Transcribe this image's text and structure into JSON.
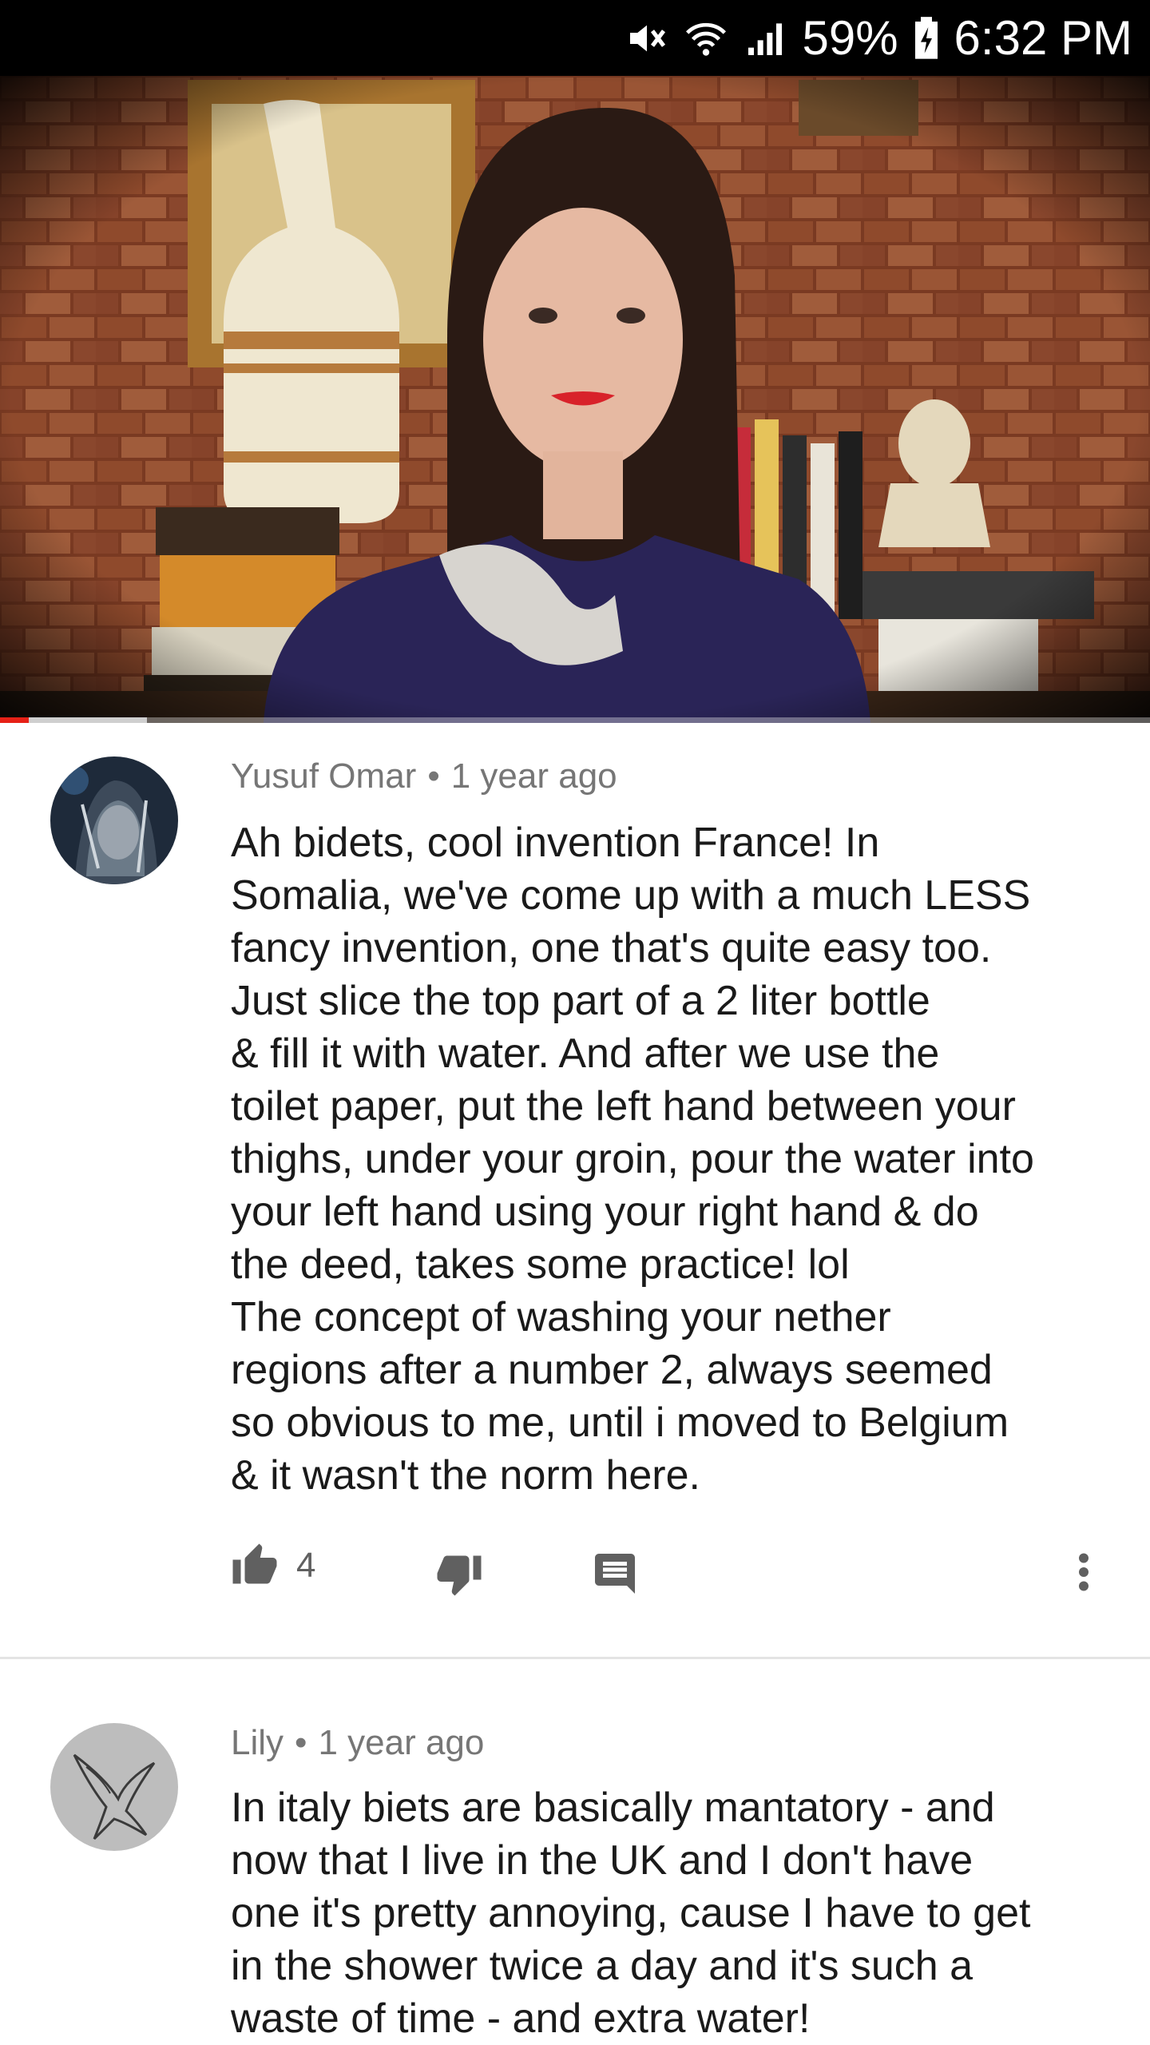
{
  "status_bar": {
    "battery_percent": "59%",
    "time": "6:32 PM",
    "icons": [
      "mute-icon",
      "wifi-icon",
      "signal-icon",
      "battery-charging-icon"
    ]
  },
  "video": {
    "progress_watched": 0.025,
    "progress_buffered": 0.128,
    "accent_color": "#e62117"
  },
  "comments": [
    {
      "author": "Yusuf Omar",
      "separator": "•",
      "time": "1 year ago",
      "text": "Ah bidets, cool invention France! In\nSomalia, we've come up with a much LESS\nfancy invention, one that's quite easy too.\nJust slice the top part of a 2 liter bottle\n& fill it with water. And after we use the\ntoilet paper, put the left hand between your\nthighs, under your groin, pour the water into\nyour left hand using your right hand & do\nthe deed, takes some practice! lol\nThe concept of washing your nether\nregions after a number 2, always seemed\nso obvious to me, until i moved to Belgium\n& it wasn't the norm here.",
      "like_count": "4",
      "avatar_icon": "hooded-figure-avatar"
    },
    {
      "author": "Lily",
      "separator": "•",
      "time": "1 year ago",
      "text": "In italy biets are basically mantatory - and\nnow that I live in the UK and I don't have\none it's pretty annoying, cause I have to get\nin the shower twice a day and it's such a\nwaste of time - and extra water!",
      "avatar_icon": "swallow-tattoo-avatar"
    }
  ]
}
